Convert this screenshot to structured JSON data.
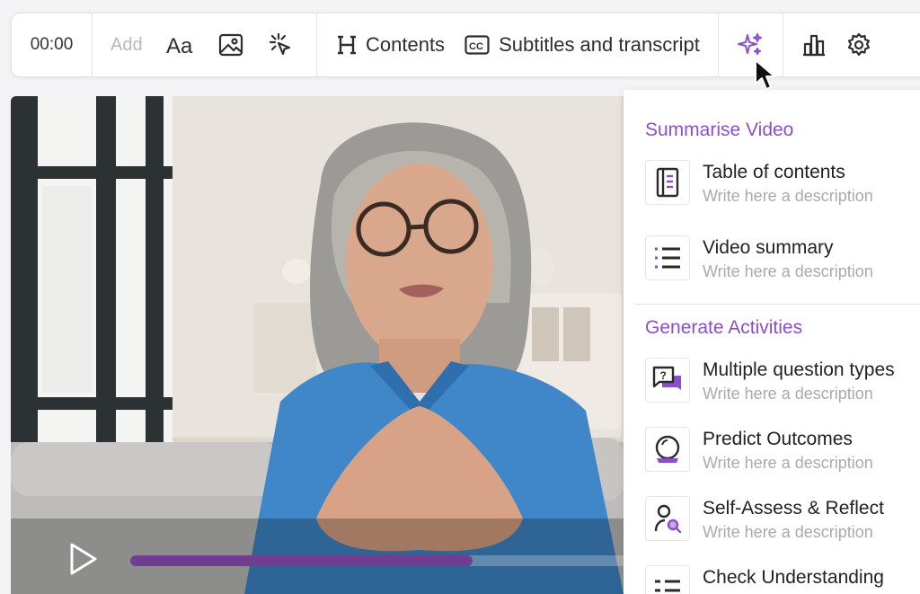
{
  "toolbar": {
    "time": "00:00",
    "add_label": "Add",
    "contents_label": "Contents",
    "subtitles_label": "Subtitles and transcript",
    "icons": [
      "text-format-icon",
      "image-icon",
      "click-interaction-icon",
      "heading-icon",
      "closed-caption-icon",
      "ai-sparkle-icon",
      "bar-chart-icon",
      "gear-icon"
    ]
  },
  "video": {
    "progress_fraction": 0.68
  },
  "panel": {
    "summarise": {
      "title": "Summarise Video",
      "items": [
        {
          "title": "Table of contents",
          "description": "Write here a description",
          "icon": "table-of-contents-icon"
        },
        {
          "title": "Video summary",
          "description": "Write here a description",
          "icon": "list-icon"
        }
      ]
    },
    "generate": {
      "title": "Generate Activities",
      "items": [
        {
          "title": "Multiple question types",
          "description": "Write here a description",
          "icon": "question-chat-icon"
        },
        {
          "title": "Predict Outcomes",
          "description": "Write here a description",
          "icon": "crystal-ball-icon"
        },
        {
          "title": "Self-Assess & Reflect",
          "description": "Write here a description",
          "icon": "self-assess-icon"
        },
        {
          "title": "Check Understanding",
          "description": "",
          "icon": "check-list-icon"
        }
      ]
    }
  },
  "colors": {
    "accent": "#8a4fc7",
    "progress": "#6f3d92"
  }
}
